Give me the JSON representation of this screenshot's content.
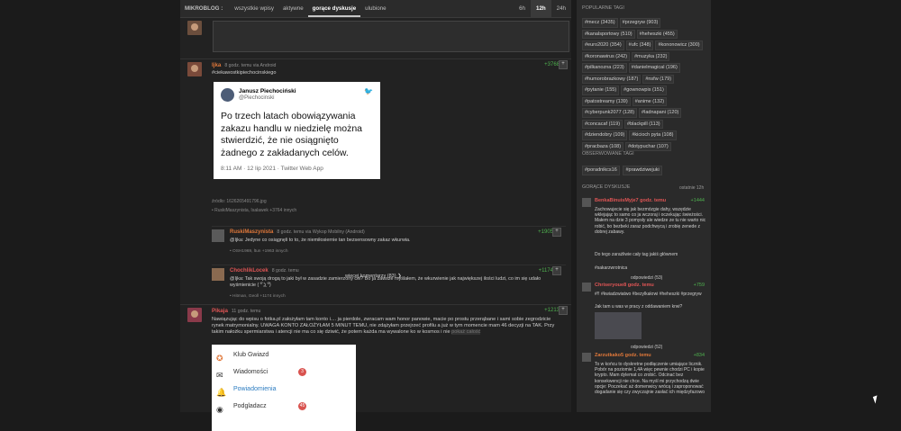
{
  "topbar": {
    "brand": "MIKROBLOG :",
    "nav": [
      "wszystkie wpisy",
      "aktywne",
      "gorące dyskusje",
      "ulubione"
    ],
    "active_nav": "gorące dyskusje",
    "time_filters": [
      "6h",
      "12h",
      "24h"
    ],
    "active_time": "12h"
  },
  "entry1": {
    "author": "Ijka",
    "meta": "8 godz. temu  via Android",
    "tag": "#ciekawostkipiechocinskiego",
    "votes": "+3768",
    "tweet": {
      "name": "Janusz Piechociński",
      "handle": "@Piechocinski",
      "text": "Po trzech latach obowiązywania zakazu handlu w niedzielę można stwierdzić, że nie osiągnięto żadnego z zakładanych celów.",
      "date": "8:11 AM · 12 lip 2021 · Twitter Web App"
    },
    "image_caption": "źródło: 1626265491796.jpg",
    "voters": "• RuskiMaszynista, Isalawek +3764 innych"
  },
  "comments": [
    {
      "author": "RuskiMaszynista",
      "meta": "8 godz. temu  via Wykop Mobilny (Android)",
      "text": "@Ijka: Jedyne co osiągnęli to to, że niemiłosiernie tan bezsensowny zakaz wkurwia.",
      "voters": "• OSH1969, ltun +1963 innych",
      "votes": "+1905",
      "color": "#e0783a"
    },
    {
      "author": "ChochlikLocek",
      "meta": "8 godz. temu",
      "text": "@Ijka: Tak swoją drogą to jaki był w zasadzie zamierzony cel? Bo ja zawsze myślałem, że wkurwienie jak największej ilości ludzi, co im się udało wyśmienicie ( ͡° ͜ʖ ͡°)",
      "voters": "• Hitman, Geoll +1174 innych",
      "votes": "+1174",
      "color": "#e05555"
    }
  ],
  "more_comments": "więcej komentarzy (83)",
  "entry2": {
    "author": "Pikaja",
    "meta": "11 godz. temu",
    "votes": "+1213",
    "text": "Nawiązując do wpisu o fotka.pl założyłam tam konto i.... ja pierdole, zwracam wam honor panowie, macie po prostu przerąbane i sami sobie zegrodzicie rynek matrymonialny. UWAGA KONTO ZAŁOŻYŁAM 5 MINUT TEMU, nie zdążyłam przejrzeć profilu a już w tym momencie mam 46 decyzji na TAK. Przy takim nałożku spermiarstwa i atencji nie ma co się dziwić, że potem każda ma wywalone ko w kosmos i nie",
    "show_all": "pokaż całość",
    "menu": [
      {
        "label": "Klub Gwiazd",
        "badge": ""
      },
      {
        "label": "Wiadomości",
        "badge": "3"
      },
      {
        "label": "Powiadomienia",
        "badge": ""
      },
      {
        "label": "Podgladacz",
        "badge": "45"
      }
    ]
  },
  "sidebar": {
    "popular_heading": "POPULARNE TAGI",
    "popular_tags": [
      "#mecz (3435)",
      "#przegryw (903)",
      "#kanalsportowy (510)",
      "#heheszki (455)",
      "#euro2020 (354)",
      "#ufc (348)",
      "#kononowicz (300)",
      "#koronawirus (242)",
      "#muzyka (232)",
      "#pilkanozna (223)",
      "#danielmagical (196)",
      "#humorobrazkowy (187)",
      "#nsfw (179)",
      "#pytanie (155)",
      "#gownowpis (151)",
      "#patostreamy (139)",
      "#anime (132)",
      "#cyberpunk2077 (128)",
      "#ladnapani (120)",
      "#concacaf (119)",
      "#blackpill (113)",
      "#dziendobry (109)",
      "#kicioch pyta (108)",
      "#pracbaza (108)",
      "#dotypuchar (107)"
    ],
    "observed_heading": "OBSERWOWANE TAGI",
    "observed_tags": [
      "#poradnikcs16",
      "#prawdziwejuki"
    ],
    "hot_heading": "GORĄCE DYSKUSJE",
    "hot_filters": "ostatnie 12h",
    "hot": [
      {
        "author": "BenkaBinuisMyje",
        "meta": "7 godz. temu",
        "votes": "+1444",
        "text": "Zachowujecie się jak bezmózgie dahy, wszędzie wklejając to samo co ja wczoraj i oczekując świeżości. Małem na dzie 3 pomysły ale wiedze ze tu nie warto nic robić, bo bezbeki zaraz podchwycą i zrobię zenede z dobrej zabawy.",
        "text2": "Do tego zarażliwie cały tag jakiś głównem",
        "tag": "#sakarzwrotnica",
        "replies": "odpowiedzi (53)"
      },
      {
        "author": "Chriseryoue",
        "meta": "8 godz. temu",
        "votes": "+759",
        "tags": "#!! #kwiadzwiatwo #bezylkakrwi #heheszki #przegryw",
        "text": "Jak tam u was w pracy z oddawaniem krwi?",
        "replies": "odpowiedzi (52)"
      },
      {
        "author": "Zarzutkako",
        "meta": "5 godz. temu",
        "votes": "+834",
        "text": "To w końcu to dyskretne podłączenie umiające licznik. Pobór na poziomie 1,4A więc pewnie chodzi PC i kopie krypto. Mam dylemat co zrobić. Odcinać bez konsekwencji nie chce. Na myśl mi przychodzą dwie opcje: Poczekać aż domenwicy wrócą i zaproponować dogadanie się czy zwyczajnie zasłać ich międzyfazowo"
      }
    ]
  }
}
